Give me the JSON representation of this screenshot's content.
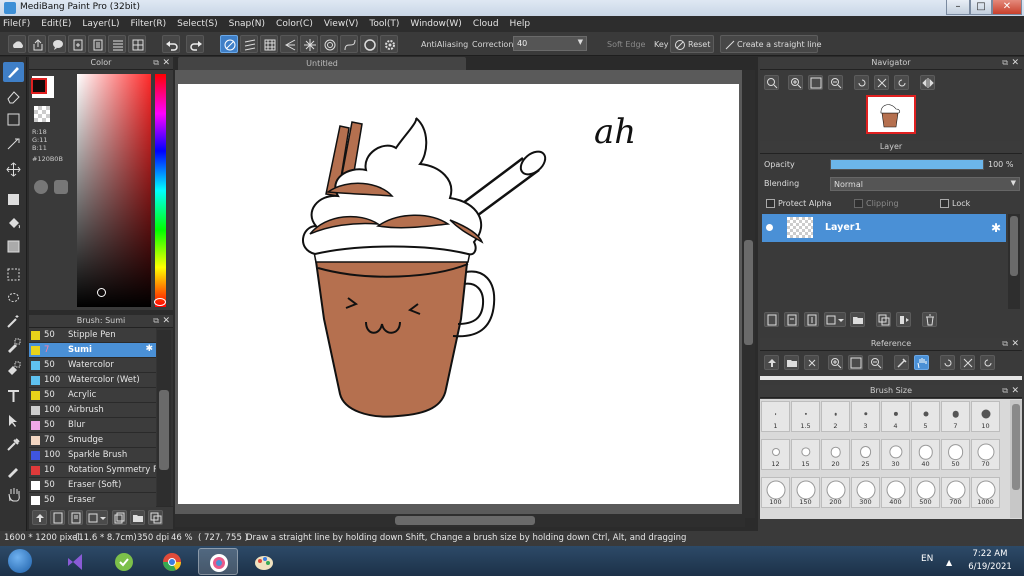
{
  "window": {
    "title": "MediBang Paint Pro (32bit)",
    "minimize": "–",
    "maximize": "□",
    "close": "✕"
  },
  "menu": [
    "File(F)",
    "Edit(E)",
    "Layer(L)",
    "Filter(R)",
    "Select(S)",
    "Snap(N)",
    "Color(C)",
    "View(V)",
    "Tool(T)",
    "Window(W)",
    "Cloud",
    "Help"
  ],
  "toolbar": {
    "antialiasing_label": "AntiAliasing",
    "antialiasing_checked": true,
    "correction_label": "Correction",
    "correction_value": "40",
    "soft_edge_label": "Soft Edge",
    "soft_edge_checked": false,
    "key_label": "Key",
    "reset_label": "Reset",
    "straight_line_label": "Create a straight line"
  },
  "color_panel": {
    "title": "Color",
    "r": "R:18",
    "g": "G:11",
    "b": "B:11",
    "hex": "#120B0B",
    "fg_color": "#120B0B"
  },
  "brush_panel": {
    "title": "Brush: Sumi",
    "items": [
      {
        "size": "50",
        "name": "Stipple Pen",
        "color": "#e8d21a"
      },
      {
        "size": "7",
        "name": "Sumi",
        "color": "#e8d21a",
        "selected": true
      },
      {
        "size": "50",
        "name": "Watercolor",
        "color": "#5fc2f0"
      },
      {
        "size": "100",
        "name": "Watercolor (Wet)",
        "color": "#5fc2f0"
      },
      {
        "size": "50",
        "name": "Acrylic",
        "color": "#e8d21a"
      },
      {
        "size": "100",
        "name": "Airbrush",
        "color": "#cfcfcf"
      },
      {
        "size": "50",
        "name": "Blur",
        "color": "#f0a8e8"
      },
      {
        "size": "70",
        "name": "Smudge",
        "color": "#f3d6c2"
      },
      {
        "size": "100",
        "name": "Sparkle Brush",
        "color": "#3f55e0"
      },
      {
        "size": "10",
        "name": "Rotation Symmetry P",
        "color": "#e03a3a"
      },
      {
        "size": "50",
        "name": "Eraser (Soft)",
        "color": "#ffffff"
      },
      {
        "size": "50",
        "name": "Eraser",
        "color": "#ffffff"
      }
    ]
  },
  "canvas": {
    "tab_title": "Untitled",
    "handwriting": "ah"
  },
  "navigator": {
    "title": "Navigator"
  },
  "layer_panel": {
    "title": "Layer",
    "opacity_label": "Opacity",
    "opacity_value": "100 %",
    "opacity_fraction": 1.0,
    "blending_label": "Blending",
    "blending_value": "Normal",
    "protect_alpha": "Protect Alpha",
    "clipping": "Clipping",
    "lock": "Lock",
    "layers": [
      {
        "name": "Layer1"
      }
    ]
  },
  "reference": {
    "title": "Reference"
  },
  "brush_size": {
    "title": "Brush Size",
    "sizes": [
      "1",
      "1.5",
      "2",
      "3",
      "4",
      "5",
      "7",
      "10",
      "12",
      "15",
      "20",
      "25",
      "30",
      "40",
      "50",
      "70",
      "100",
      "150",
      "200",
      "300",
      "400",
      "500",
      "700",
      "1000"
    ]
  },
  "status": {
    "dimensions": "1600 * 1200 pixel",
    "physical": "(11.6 * 8.7cm)",
    "dpi": "350 dpi",
    "zoom": "46 %",
    "cursor": "( 727, 755 )",
    "hint": "Draw a straight line by holding down Shift, Change a brush size by holding down Ctrl, Alt, and dragging"
  },
  "taskbar": {
    "lang": "EN",
    "time": "7:22 AM",
    "date": "6/19/2021"
  },
  "colors": {
    "accent": "#4a90d6",
    "cocoa": "#b5704f",
    "ink": "#111111"
  }
}
